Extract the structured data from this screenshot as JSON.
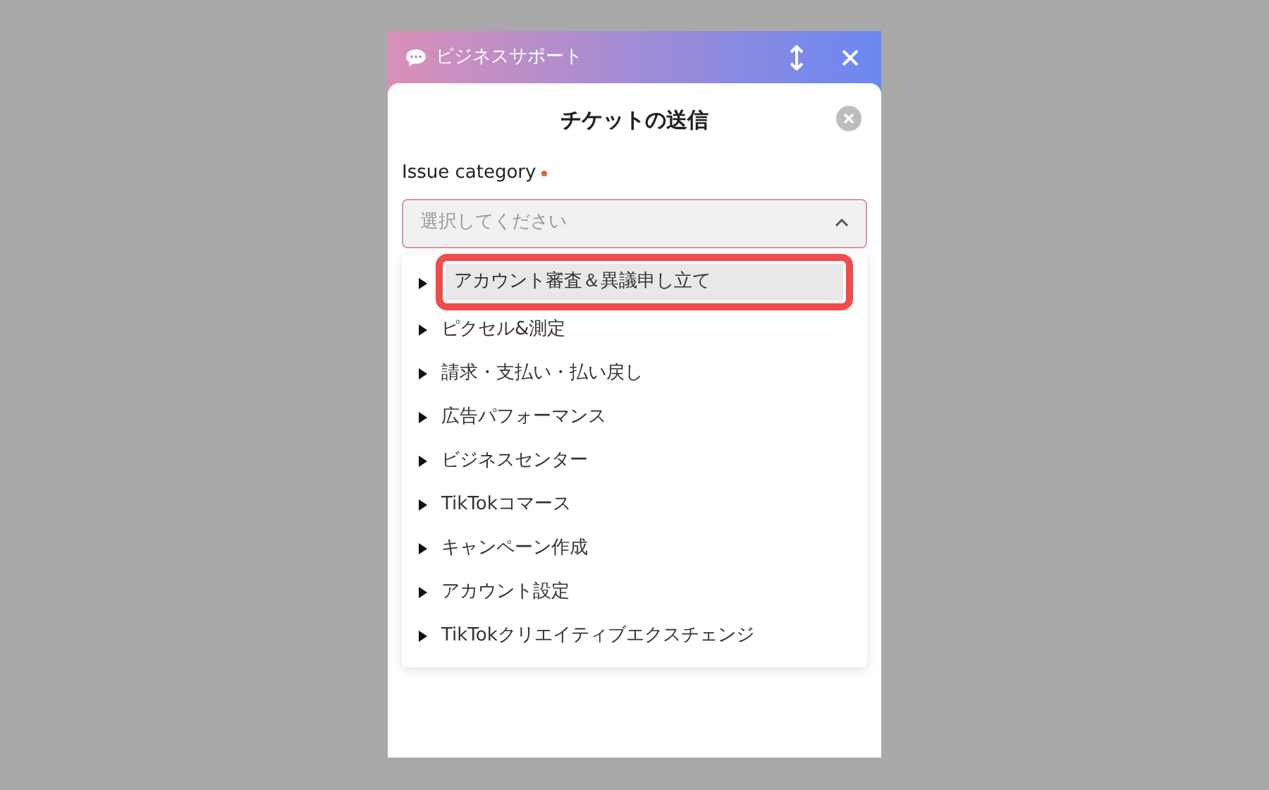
{
  "header": {
    "title": "ビジネスサポート"
  },
  "dialog": {
    "title": "チケットの送信"
  },
  "field": {
    "label": "Issue category",
    "required": true,
    "placeholder": "選択してください",
    "expanded": true
  },
  "options": [
    {
      "label": "アカウント審査＆異議申し立て",
      "selected": true,
      "expanded": false
    },
    {
      "label": "ピクセル&測定",
      "selected": false,
      "expanded": false
    },
    {
      "label": "請求・支払い・払い戻し",
      "selected": false,
      "expanded": false
    },
    {
      "label": "広告パフォーマンス",
      "selected": false,
      "expanded": false
    },
    {
      "label": "ビジネスセンター",
      "selected": false,
      "expanded": false
    },
    {
      "label": "TikTokコマース",
      "selected": false,
      "expanded": false
    },
    {
      "label": "キャンペーン作成",
      "selected": false,
      "expanded": false
    },
    {
      "label": "アカウント設定",
      "selected": false,
      "expanded": false
    },
    {
      "label": "TikTokクリエイティブエクスチェンジ",
      "selected": false,
      "expanded": false
    }
  ]
}
